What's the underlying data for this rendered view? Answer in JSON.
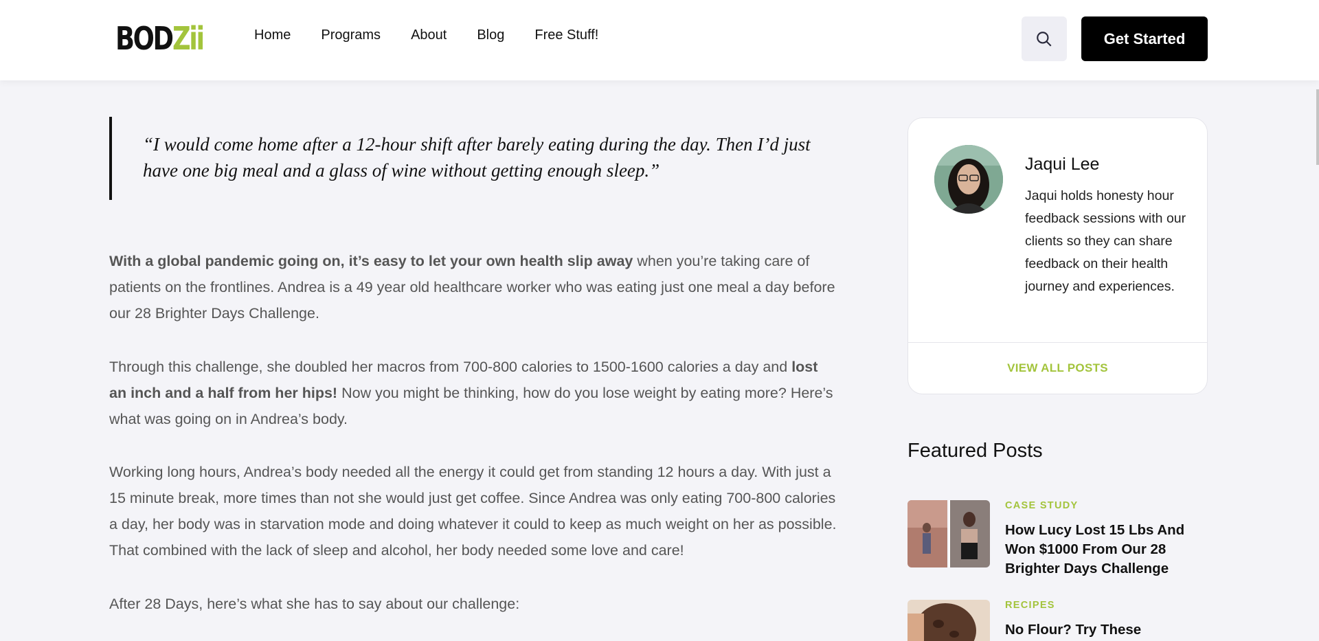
{
  "header": {
    "logo": {
      "part1": "BOD",
      "part2": "Zii"
    },
    "nav": [
      "Home",
      "Programs",
      "About",
      "Blog",
      "Free Stuff!"
    ],
    "cta_label": "Get Started",
    "search_icon": "search-icon"
  },
  "article": {
    "quote": "“I would come home after a 12-hour shift after barely eating during the day. Then I’d just have one big meal and a glass of wine without getting enough sleep.”",
    "p1_bold": "With a global pandemic going on, it’s easy to let your own health slip away",
    "p1_rest": " when you’re taking care of patients on the frontlines. Andrea is a 49 year old healthcare worker who was eating just one meal a day before our 28 Brighter Days Challenge.",
    "p2_start": "Through this challenge, she doubled her macros from 700-800 calories to 1500-1600 calories a day and ",
    "p2_bold": "lost an inch and a half from her hips!",
    "p2_end": " Now you might be thinking, how do you lose weight by eating more? Here’s what was going on in Andrea’s body.",
    "p3": "Working long hours, Andrea’s body needed all the energy it could get from standing 12 hours a day. With just a 15 minute break, more times than not she would just get coffee. Since Andrea was only eating 700-800 calories a day, her body was in starvation mode and doing whatever it could to keep as much weight on her as possible. That combined with the lack of sleep and alcohol, her body needed some love and care!",
    "p4": "After 28 Days, here’s what she has to say about our challenge:"
  },
  "author": {
    "name": "Jaqui Lee",
    "bio": "Jaqui holds honesty hour feedback sessions with our clients so they can share feedback on their health journey and experiences.",
    "view_all": "VIEW ALL POSTS"
  },
  "featured": {
    "title": "Featured Posts",
    "posts": [
      {
        "category": "CASE STUDY",
        "title": "How Lucy Lost 15 Lbs And Won $1000 From Our 28 Brighter Days Challenge"
      },
      {
        "category": "RECIPES",
        "title": "No Flour? Try These"
      }
    ]
  },
  "colors": {
    "accent": "#a3c43c",
    "text": "#555555",
    "heading": "#111111",
    "background": "#f4f4f8"
  }
}
